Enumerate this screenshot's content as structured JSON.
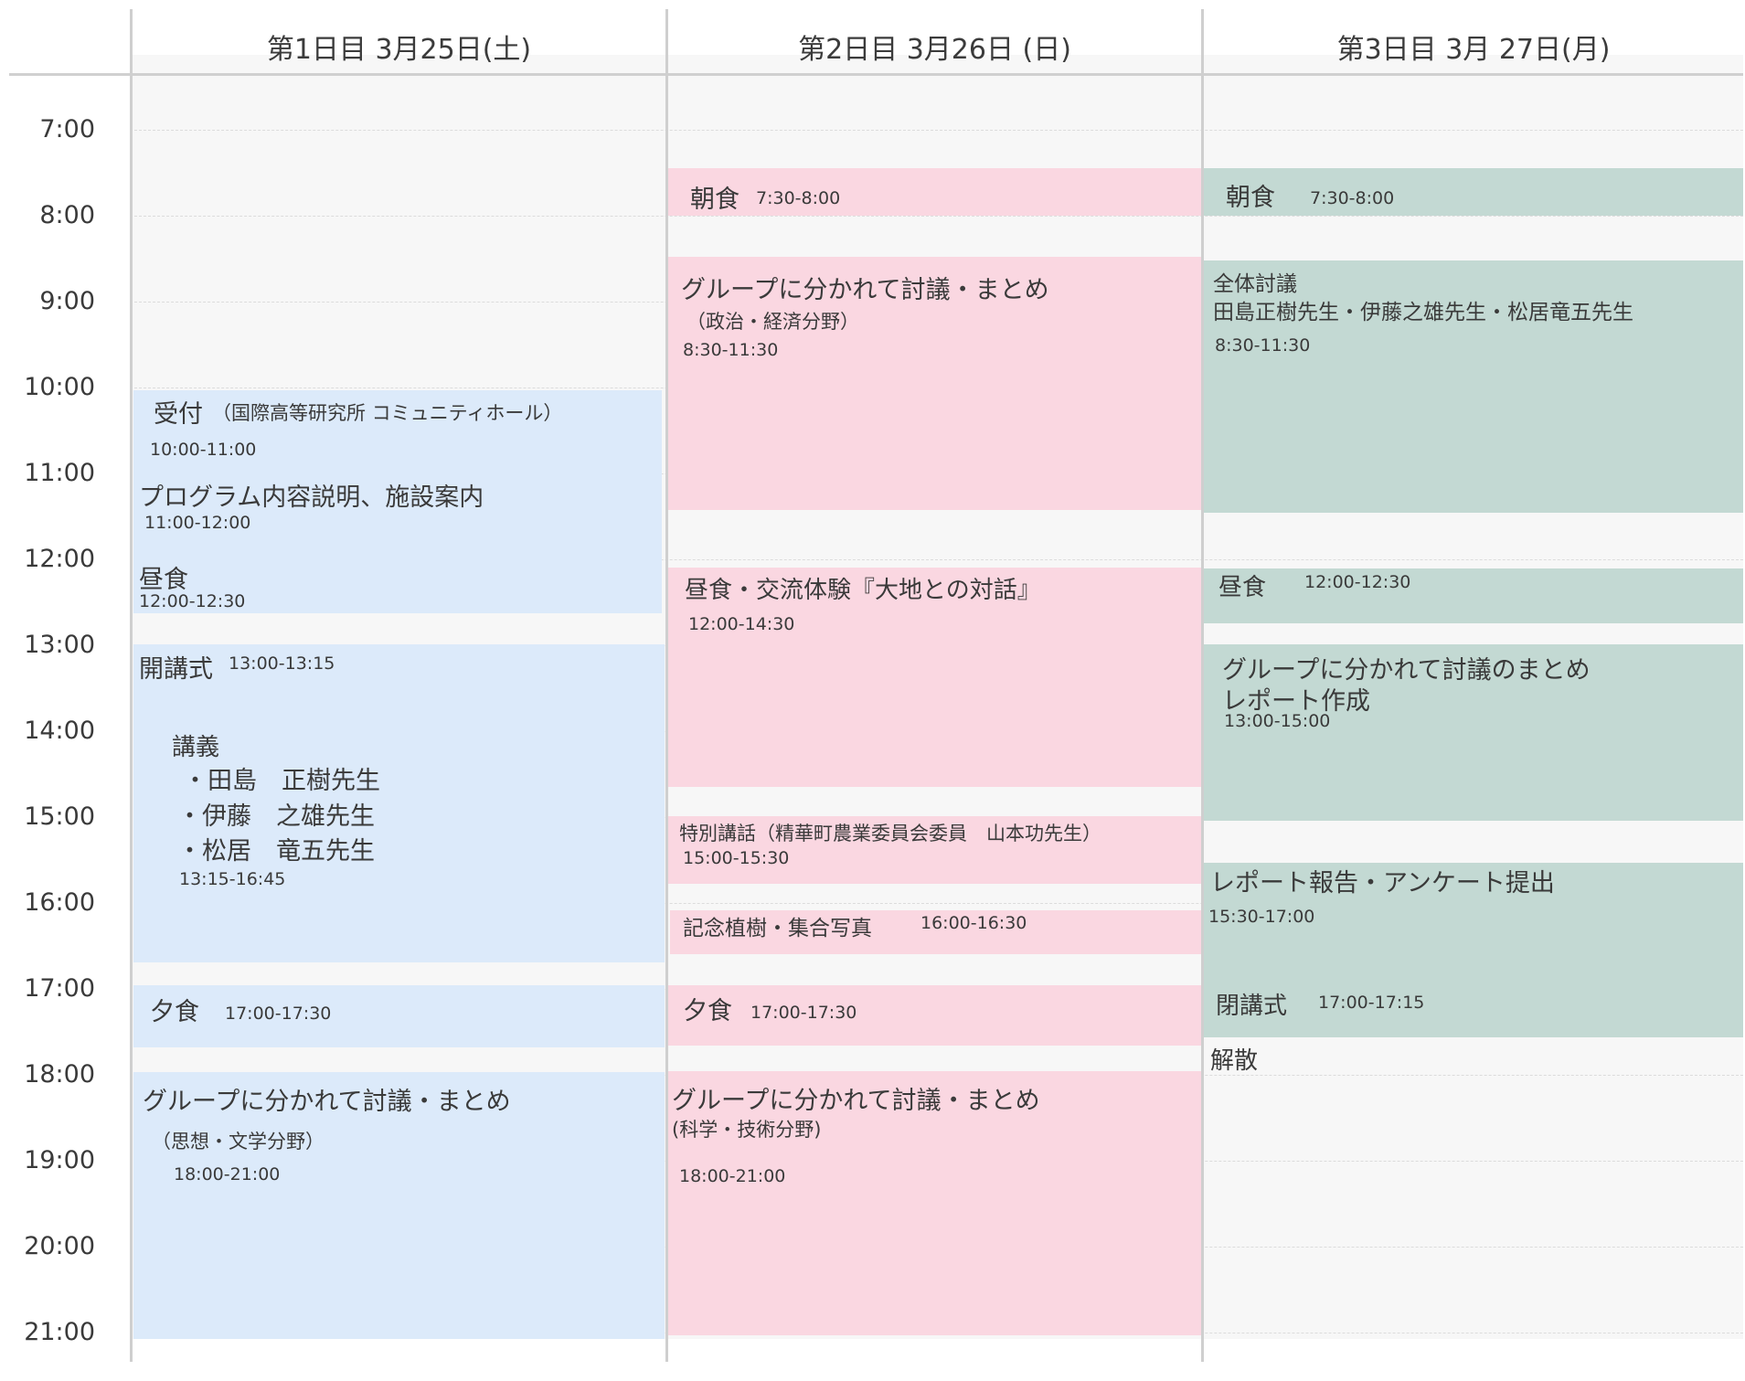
{
  "days": [
    {
      "label": "第1日目 3月25日(土)"
    },
    {
      "label": "第2日目  3月26日 (日)"
    },
    {
      "label": "第3日目  3月 27日(月)"
    }
  ],
  "times": [
    "7:00",
    "8:00",
    "9:00",
    "10:00",
    "11:00",
    "12:00",
    "13:00",
    "14:00",
    "15:00",
    "16:00",
    "17:00",
    "18:00",
    "19:00",
    "20:00",
    "21:00"
  ],
  "day1": {
    "reception_title": "受付",
    "reception_place": "（国際高等研究所 コミュニティホール）",
    "reception_time": "10:00-11:00",
    "program_title": "プログラム内容説明、施設案内",
    "program_time": "11:00-12:00",
    "lunch_title": "昼食",
    "lunch_time": "12:00-12:30",
    "opening_title": "開講式",
    "opening_time": "13:00-13:15",
    "lecture_title": "講義",
    "lecture_items": [
      "・田島　正樹先生",
      "・伊藤　之雄先生",
      "・松居　竜五先生"
    ],
    "lecture_time": "13:15-16:45",
    "dinner_title": "夕食",
    "dinner_time": "17:00-17:30",
    "group_title": "グループに分かれて討議・まとめ",
    "group_sub": "（思想・文学分野）",
    "group_time": "18:00-21:00"
  },
  "day2": {
    "breakfast_title": "朝食",
    "breakfast_time": "7:30-8:00",
    "group1_title": "グループに分かれて討議・まとめ",
    "group1_sub": "（政治・経済分野）",
    "group1_time": "8:30-11:30",
    "lunch_title": "昼食・交流体験『大地との対話』",
    "lunch_time": "12:00-14:30",
    "special_title": "特別講話（精華町農業委員会委員　山本功先生）",
    "special_time": "15:00-15:30",
    "tree_title": "記念植樹・集合写真",
    "tree_time": "16:00-16:30",
    "dinner_title": "夕食",
    "dinner_time": "17:00-17:30",
    "group2_title": "グループに分かれて討議・まとめ",
    "group2_sub": "(科学・技術分野)",
    "group2_time": "18:00-21:00"
  },
  "day3": {
    "breakfast_title": "朝食",
    "breakfast_time": "7:30-8:00",
    "plenary_title": "全体討議",
    "plenary_people": "田島正樹先生・伊藤之雄先生・松居竜五先生",
    "plenary_time": "8:30-11:30",
    "lunch_title": "昼食",
    "lunch_time": "12:00-12:30",
    "group_title": "グループに分かれて討議のまとめ",
    "group_sub": "レポート作成",
    "group_time": "13:00-15:00",
    "report_title": "レポート報告・アンケート提出",
    "report_time": "15:30-17:00",
    "closing_title": "閉講式",
    "closing_time": "17:00-17:15",
    "dismiss_title": "解散"
  },
  "colors": {
    "day1": "#dceafa",
    "day2": "#fad7e1",
    "day3": "#c3d9d3",
    "grid": "#cfcfcf"
  }
}
